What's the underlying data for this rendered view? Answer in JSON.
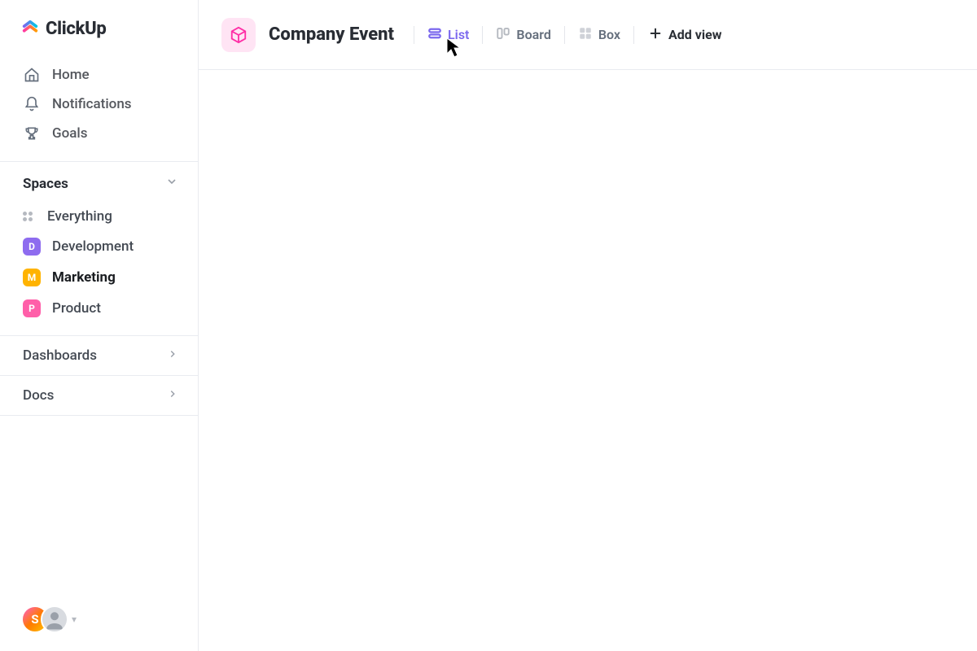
{
  "brand": {
    "name": "ClickUp"
  },
  "sidebar": {
    "nav": [
      {
        "label": "Home",
        "icon": "home"
      },
      {
        "label": "Notifications",
        "icon": "bell"
      },
      {
        "label": "Goals",
        "icon": "trophy"
      }
    ],
    "spaces_header": "Spaces",
    "everything_label": "Everything",
    "spaces": [
      {
        "label": "Development",
        "letter": "D",
        "color": "#8e6cef"
      },
      {
        "label": "Marketing",
        "letter": "M",
        "color": "#ffb300",
        "active": true
      },
      {
        "label": "Product",
        "letter": "P",
        "color": "#ff5fa9"
      }
    ],
    "sections": [
      {
        "label": "Dashboards"
      },
      {
        "label": "Docs"
      }
    ],
    "avatar_letter": "S"
  },
  "header": {
    "title": "Company Event",
    "views": [
      {
        "label": "List",
        "icon": "list",
        "active": true
      },
      {
        "label": "Board",
        "icon": "board"
      },
      {
        "label": "Box",
        "icon": "box"
      }
    ],
    "add_view_label": "Add view"
  }
}
